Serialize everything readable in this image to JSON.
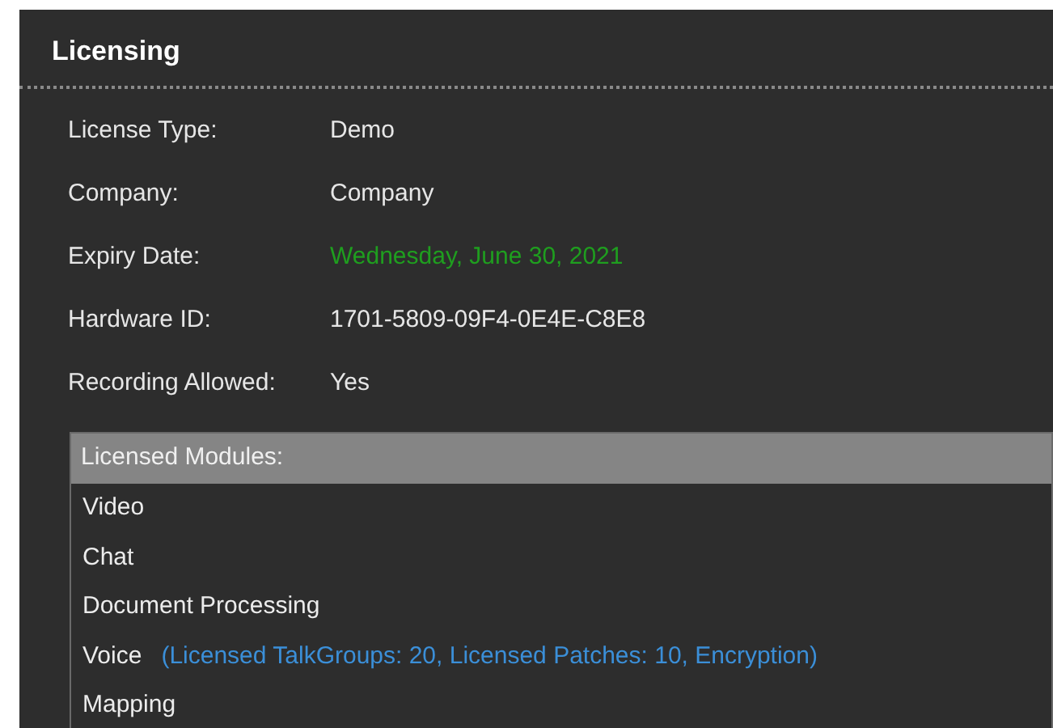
{
  "panel": {
    "title": "Licensing"
  },
  "fields": [
    {
      "label": "License Type:",
      "value": "Demo",
      "color": "#e6e6e6"
    },
    {
      "label": "Company:",
      "value": "Company",
      "color": "#e6e6e6"
    },
    {
      "label": "Expiry Date:",
      "value": "Wednesday, June 30, 2021",
      "color": "#1f9e1f"
    },
    {
      "label": "Hardware ID:",
      "value": "1701-5809-09F4-0E4E-C8E8",
      "color": "#e6e6e6"
    },
    {
      "label": "Recording Allowed:",
      "value": "Yes",
      "color": "#e6e6e6"
    }
  ],
  "modules": {
    "header": "Licensed Modules:",
    "items": [
      {
        "name": "Video"
      },
      {
        "name": "Chat"
      },
      {
        "name": "Document Processing"
      },
      {
        "name": "Voice",
        "details": "(Licensed TalkGroups: 20, Licensed Patches: 10, Encryption)"
      },
      {
        "name": "Mapping"
      }
    ]
  }
}
